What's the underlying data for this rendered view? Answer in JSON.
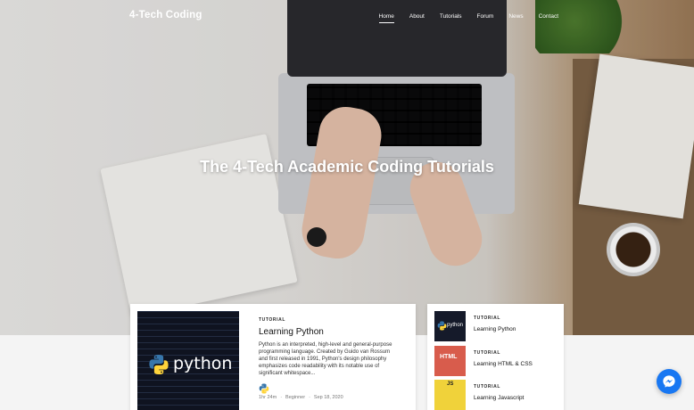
{
  "brand": "4-Tech Coding",
  "nav": {
    "items": [
      {
        "label": "Home",
        "active": true
      },
      {
        "label": "About",
        "active": false
      },
      {
        "label": "Tutorials",
        "active": false
      },
      {
        "label": "Forum",
        "active": false
      },
      {
        "label": "News",
        "active": false
      },
      {
        "label": "Contact",
        "active": false
      }
    ]
  },
  "hero": {
    "title": "The 4-Tech Academic Coding Tutorials"
  },
  "featured": {
    "tag": "TUTORIAL",
    "title": "Learning Python",
    "description": "Python is an interpreted, high-level and general-purpose programming language. Created by Guido van Rossum and first released in 1991, Python's design philosophy emphasizes code readability with its notable use of significant whitespace...",
    "thumb_word": "python",
    "meta": {
      "duration": "1hr 24m",
      "level": "Beginner",
      "date": "Sep 18, 2020"
    }
  },
  "side": {
    "items": [
      {
        "tag": "TUTORIAL",
        "title": "Learning Python",
        "thumb_label": "python"
      },
      {
        "tag": "TUTORIAL",
        "title": "Learning HTML & CSS",
        "thumb_label": "HTML"
      },
      {
        "tag": "TUTORIAL",
        "title": "Learning Javascript",
        "thumb_label": "JS"
      }
    ]
  },
  "colors": {
    "accent": "#1877f2",
    "python_blue": "#3776ab",
    "python_yellow": "#ffd43b"
  }
}
